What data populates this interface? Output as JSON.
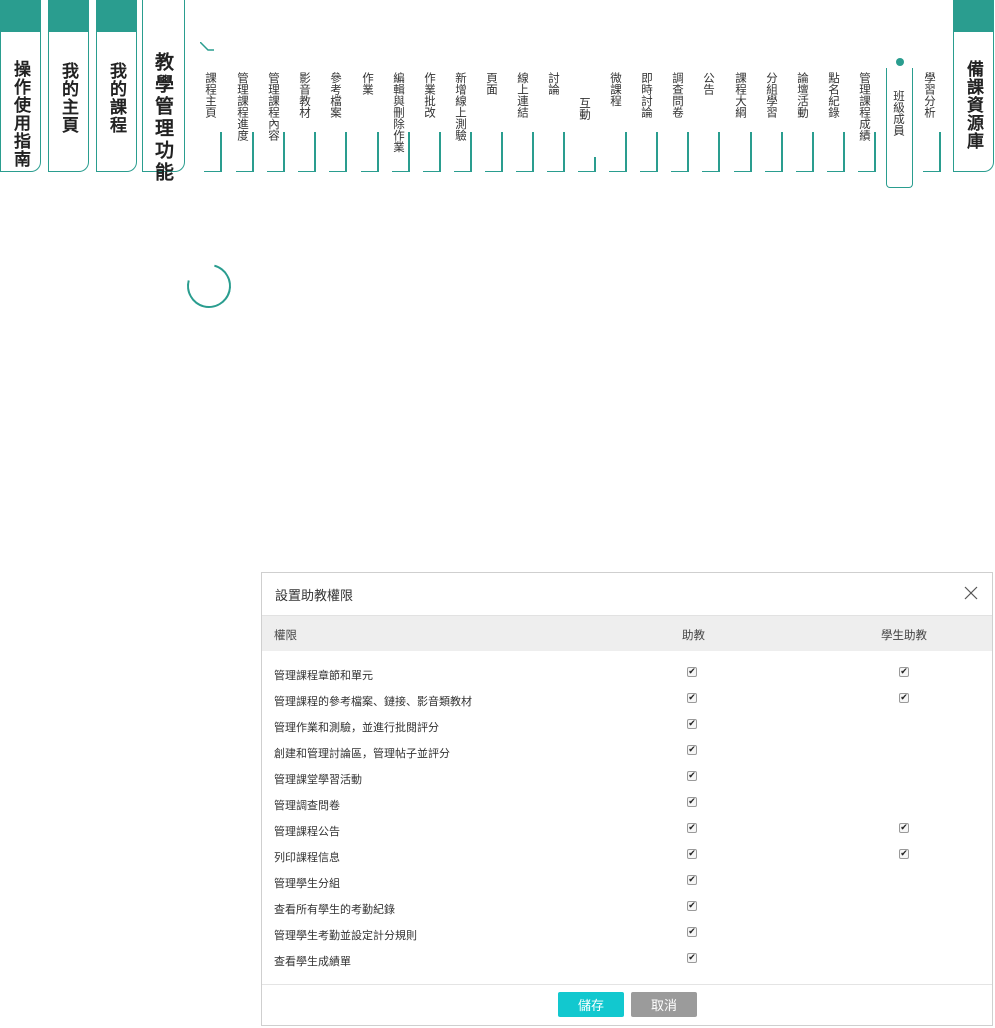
{
  "nav": {
    "guide": "操作使用指南",
    "home": "我的主頁",
    "my_courses": "我的課程",
    "teaching": "教學管理功能",
    "resources": "備課資源庫"
  },
  "subnav": [
    "課程主頁",
    "管理課程進度",
    "管理課程內容",
    "影音教材",
    "參考檔案",
    "作業",
    "編輯與刪除作業",
    "作業批改",
    "新增線上測驗",
    "頁面",
    "線上連結",
    "討論",
    "互動",
    "微課程",
    "即時討論",
    "調查問卷",
    "公告",
    "課程大綱",
    "分組學習",
    "論壇活動",
    "點名紀錄",
    "管理課程成績",
    "班級成員",
    "學習分析"
  ],
  "active_subnav": "班級成員",
  "dialog": {
    "title": "設置助教權限",
    "columns": {
      "permission": "權限",
      "assistant": "助教",
      "student_assistant": "學生助教"
    },
    "rows": [
      {
        "label": "管理課程章節和單元",
        "assistant": true,
        "student_assistant": true
      },
      {
        "label": "管理課程的參考檔案、鏈接、影音類教材",
        "assistant": true,
        "student_assistant": true
      },
      {
        "label": "管理作業和測驗，並進行批閱評分",
        "assistant": true,
        "student_assistant": false
      },
      {
        "label": "創建和管理討論區，管理帖子並評分",
        "assistant": true,
        "student_assistant": false
      },
      {
        "label": "管理課堂學習活動",
        "assistant": true,
        "student_assistant": false
      },
      {
        "label": "管理調查問卷",
        "assistant": true,
        "student_assistant": false
      },
      {
        "label": "管理課程公告",
        "assistant": true,
        "student_assistant": true
      },
      {
        "label": "列印課程信息",
        "assistant": true,
        "student_assistant": true
      },
      {
        "label": "管理學生分組",
        "assistant": true,
        "student_assistant": false
      },
      {
        "label": "查看所有學生的考勤紀錄",
        "assistant": true,
        "student_assistant": false
      },
      {
        "label": "管理學生考勤並設定計分規則",
        "assistant": true,
        "student_assistant": false
      },
      {
        "label": "查看學生成績單",
        "assistant": true,
        "student_assistant": false
      }
    ],
    "save": "儲存",
    "cancel": "取消"
  },
  "colors": {
    "accent": "#2a9d8f",
    "save_button": "#12c8cf",
    "cancel_button": "#9b9b9b"
  }
}
